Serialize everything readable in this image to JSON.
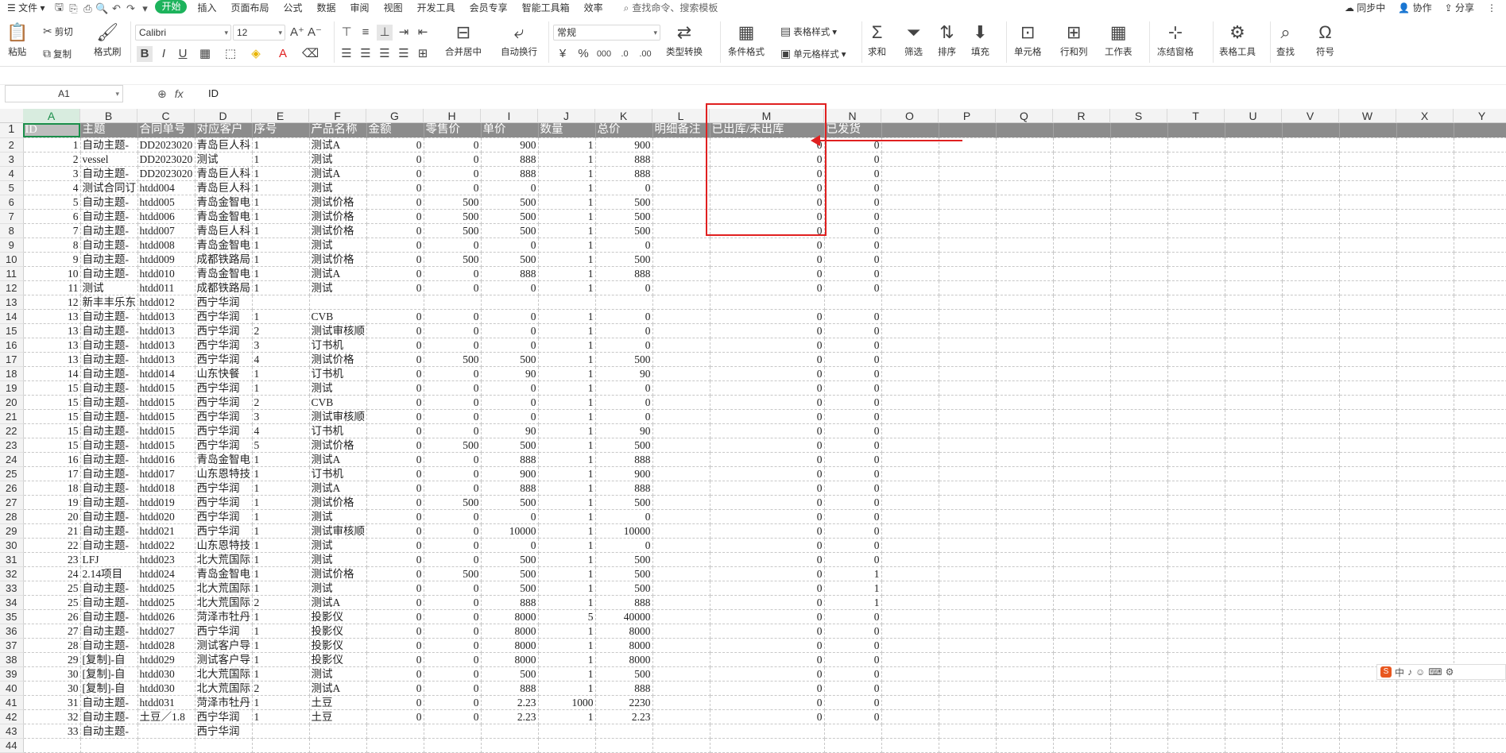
{
  "menubar": {
    "file": "文件",
    "tabs": [
      "开始",
      "插入",
      "页面布局",
      "公式",
      "数据",
      "审阅",
      "视图",
      "开发工具",
      "会员专享",
      "智能工具箱",
      "效率"
    ],
    "active_tab": "开始",
    "search_placeholder": "查找命令、搜索模板",
    "right": [
      "同步中",
      "协作",
      "分享"
    ]
  },
  "ribbon": {
    "paste": "粘贴",
    "cut": "剪切",
    "copy": "复制",
    "format_painter": "格式刷",
    "font": "Calibri",
    "size": "12",
    "merge": "合并居中",
    "wrap": "自动换行",
    "number_format": "常规",
    "type_convert": "类型转换",
    "cond_format": "条件格式",
    "table_style": "表格样式",
    "cell_style": "单元格样式",
    "sum": "求和",
    "filter": "筛选",
    "sort": "排序",
    "fill": "填充",
    "cell": "单元格",
    "rowcol": "行和列",
    "sheet": "工作表",
    "freeze": "冻结窗格",
    "table_tools": "表格工具",
    "find": "查找",
    "symbol": "符号"
  },
  "formula_bar": {
    "name_box": "A1",
    "content": "ID"
  },
  "columns": [
    "A",
    "B",
    "C",
    "D",
    "E",
    "F",
    "G",
    "H",
    "I",
    "J",
    "K",
    "L",
    "M",
    "N",
    "O",
    "P",
    "Q",
    "R",
    "S",
    "T",
    "U",
    "V",
    "W",
    "X",
    "Y"
  ],
  "header_row": [
    "ID",
    "主题",
    "合同单号",
    "对应客户",
    "序号",
    "产品名称",
    "金额",
    "零售价",
    "单价",
    "数量",
    "总价",
    "明细备注",
    "已出库/未出库",
    "已发货"
  ],
  "rows": [
    [
      "1",
      "自动主题-",
      "DD2023020",
      "青岛巨人科",
      "1",
      "测试A",
      "0",
      "0",
      "900",
      "1",
      "900",
      "",
      "0",
      "0"
    ],
    [
      "2",
      "vessel",
      "DD2023020",
      "测试",
      "1",
      "测试",
      "0",
      "0",
      "888",
      "1",
      "888",
      "",
      "0",
      "0"
    ],
    [
      "3",
      "自动主题-",
      "DD2023020",
      "青岛巨人科",
      "1",
      "测试A",
      "0",
      "0",
      "888",
      "1",
      "888",
      "",
      "0",
      "0"
    ],
    [
      "4",
      "测试合同订",
      "htdd004",
      "青岛巨人科",
      "1",
      "测试",
      "0",
      "0",
      "0",
      "1",
      "0",
      "",
      "0",
      "0"
    ],
    [
      "5",
      "自动主题-",
      "htdd005",
      "青岛金智电",
      "1",
      "测试价格",
      "0",
      "500",
      "500",
      "1",
      "500",
      "",
      "0",
      "0"
    ],
    [
      "6",
      "自动主题-",
      "htdd006",
      "青岛金智电",
      "1",
      "测试价格",
      "0",
      "500",
      "500",
      "1",
      "500",
      "",
      "0",
      "0"
    ],
    [
      "7",
      "自动主题-",
      "htdd007",
      "青岛巨人科",
      "1",
      "测试价格",
      "0",
      "500",
      "500",
      "1",
      "500",
      "",
      "0",
      "0"
    ],
    [
      "8",
      "自动主题-",
      "htdd008",
      "青岛金智电",
      "1",
      "测试",
      "0",
      "0",
      "0",
      "1",
      "0",
      "",
      "0",
      "0"
    ],
    [
      "9",
      "自动主题-",
      "htdd009",
      "成都铁路局",
      "1",
      "测试价格",
      "0",
      "500",
      "500",
      "1",
      "500",
      "",
      "0",
      "0"
    ],
    [
      "10",
      "自动主题-",
      "htdd010",
      "青岛金智电",
      "1",
      "测试A",
      "0",
      "0",
      "888",
      "1",
      "888",
      "",
      "0",
      "0"
    ],
    [
      "11",
      "测试",
      "htdd011",
      "成都铁路局",
      "1",
      "测试",
      "0",
      "0",
      "0",
      "1",
      "0",
      "",
      "0",
      "0"
    ],
    [
      "12",
      "新丰丰乐东",
      "htdd012",
      "西宁华润",
      "",
      "",
      "",
      "",
      "",
      "",
      "",
      "",
      "",
      ""
    ],
    [
      "13",
      "自动主题-",
      "htdd013",
      "西宁华润",
      "1",
      "CVB",
      "0",
      "0",
      "0",
      "1",
      "0",
      "",
      "0",
      "0"
    ],
    [
      "13",
      "自动主题-",
      "htdd013",
      "西宁华润",
      "2",
      "测试审核顺",
      "0",
      "0",
      "0",
      "1",
      "0",
      "",
      "0",
      "0"
    ],
    [
      "13",
      "自动主题-",
      "htdd013",
      "西宁华润",
      "3",
      "订书机",
      "0",
      "0",
      "0",
      "1",
      "0",
      "",
      "0",
      "0"
    ],
    [
      "13",
      "自动主题-",
      "htdd013",
      "西宁华润",
      "4",
      "测试价格",
      "0",
      "500",
      "500",
      "1",
      "500",
      "",
      "0",
      "0"
    ],
    [
      "14",
      "自动主题-",
      "htdd014",
      "山东快餐",
      "1",
      "订书机",
      "0",
      "0",
      "90",
      "1",
      "90",
      "",
      "0",
      "0"
    ],
    [
      "15",
      "自动主题-",
      "htdd015",
      "西宁华润",
      "1",
      "测试",
      "0",
      "0",
      "0",
      "1",
      "0",
      "",
      "0",
      "0"
    ],
    [
      "15",
      "自动主题-",
      "htdd015",
      "西宁华润",
      "2",
      "CVB",
      "0",
      "0",
      "0",
      "1",
      "0",
      "",
      "0",
      "0"
    ],
    [
      "15",
      "自动主题-",
      "htdd015",
      "西宁华润",
      "3",
      "测试审核顺",
      "0",
      "0",
      "0",
      "1",
      "0",
      "",
      "0",
      "0"
    ],
    [
      "15",
      "自动主题-",
      "htdd015",
      "西宁华润",
      "4",
      "订书机",
      "0",
      "0",
      "90",
      "1",
      "90",
      "",
      "0",
      "0"
    ],
    [
      "15",
      "自动主题-",
      "htdd015",
      "西宁华润",
      "5",
      "测试价格",
      "0",
      "500",
      "500",
      "1",
      "500",
      "",
      "0",
      "0"
    ],
    [
      "16",
      "自动主题-",
      "htdd016",
      "青岛金智电",
      "1",
      "测试A",
      "0",
      "0",
      "888",
      "1",
      "888",
      "",
      "0",
      "0"
    ],
    [
      "17",
      "自动主题-",
      "htdd017",
      "山东恩特技",
      "1",
      "订书机",
      "0",
      "0",
      "900",
      "1",
      "900",
      "",
      "0",
      "0"
    ],
    [
      "18",
      "自动主题-",
      "htdd018",
      "西宁华润",
      "1",
      "测试A",
      "0",
      "0",
      "888",
      "1",
      "888",
      "",
      "0",
      "0"
    ],
    [
      "19",
      "自动主题-",
      "htdd019",
      "西宁华润",
      "1",
      "测试价格",
      "0",
      "500",
      "500",
      "1",
      "500",
      "",
      "0",
      "0"
    ],
    [
      "20",
      "自动主题-",
      "htdd020",
      "西宁华润",
      "1",
      "测试",
      "0",
      "0",
      "0",
      "1",
      "0",
      "",
      "0",
      "0"
    ],
    [
      "21",
      "自动主题-",
      "htdd021",
      "西宁华润",
      "1",
      "测试审核顺",
      "0",
      "0",
      "10000",
      "1",
      "10000",
      "",
      "0",
      "0"
    ],
    [
      "22",
      "自动主题-",
      "htdd022",
      "山东恩特技",
      "1",
      "测试",
      "0",
      "0",
      "0",
      "1",
      "0",
      "",
      "0",
      "0"
    ],
    [
      "23",
      "LFJ",
      "htdd023",
      "北大荒国际",
      "1",
      "测试",
      "0",
      "0",
      "500",
      "1",
      "500",
      "",
      "0",
      "0"
    ],
    [
      "24",
      "2.14项目",
      "htdd024",
      "青岛金智电",
      "1",
      "测试价格",
      "0",
      "500",
      "500",
      "1",
      "500",
      "",
      "0",
      "1"
    ],
    [
      "25",
      "自动主题-",
      "htdd025",
      "北大荒国际",
      "1",
      "测试",
      "0",
      "0",
      "500",
      "1",
      "500",
      "",
      "0",
      "1"
    ],
    [
      "25",
      "自动主题-",
      "htdd025",
      "北大荒国际",
      "2",
      "测试A",
      "0",
      "0",
      "888",
      "1",
      "888",
      "",
      "0",
      "1"
    ],
    [
      "26",
      "自动主题-",
      "htdd026",
      "菏泽市牡丹",
      "1",
      "投影仪",
      "0",
      "0",
      "8000",
      "5",
      "40000",
      "",
      "0",
      "0"
    ],
    [
      "27",
      "自动主题-",
      "htdd027",
      "西宁华润",
      "1",
      "投影仪",
      "0",
      "0",
      "8000",
      "1",
      "8000",
      "",
      "0",
      "0"
    ],
    [
      "28",
      "自动主题-",
      "htdd028",
      "测试客户导",
      "1",
      "投影仪",
      "0",
      "0",
      "8000",
      "1",
      "8000",
      "",
      "0",
      "0"
    ],
    [
      "29",
      "[复制]-自",
      "htdd029",
      "测试客户导",
      "1",
      "投影仪",
      "0",
      "0",
      "8000",
      "1",
      "8000",
      "",
      "0",
      "0"
    ],
    [
      "30",
      "[复制]-自",
      "htdd030",
      "北大荒国际",
      "1",
      "测试",
      "0",
      "0",
      "500",
      "1",
      "500",
      "",
      "0",
      "0"
    ],
    [
      "30",
      "[复制]-自",
      "htdd030",
      "北大荒国际",
      "2",
      "测试A",
      "0",
      "0",
      "888",
      "1",
      "888",
      "",
      "0",
      "0"
    ],
    [
      "31",
      "自动主题-",
      "htdd031",
      "菏泽市牡丹",
      "1",
      "土豆",
      "0",
      "0",
      "2.23",
      "1000",
      "2230",
      "",
      "0",
      "0"
    ],
    [
      "32",
      "自动主题-",
      "土豆／1.8",
      "西宁华润",
      "1",
      "土豆",
      "0",
      "0",
      "2.23",
      "1",
      "2.23",
      "",
      "0",
      "0"
    ],
    [
      "33",
      "自动主题-",
      "",
      "西宁华润",
      "",
      "",
      "",
      "",
      "",
      "",
      "",
      "",
      "",
      ""
    ],
    [
      "",
      "",
      "",
      "",
      "",
      "",
      "",
      "",
      "",
      "",
      "",
      "",
      "",
      ""
    ]
  ],
  "ime_bar": [
    "中",
    "♪",
    "☺",
    "⌨",
    "⚙"
  ]
}
